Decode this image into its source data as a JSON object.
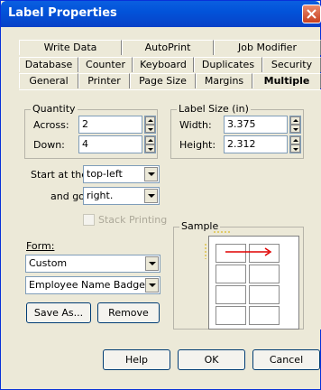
{
  "window": {
    "title": "Label Properties",
    "close_icon": "close-x-icon"
  },
  "tabs": {
    "row1": [
      "Write Data",
      "AutoPrint",
      "Job Modifier"
    ],
    "row2": [
      "Database",
      "Counter",
      "Keyboard",
      "Duplicates",
      "Security"
    ],
    "row3": [
      "General",
      "Printer",
      "Page Size",
      "Margins",
      "Multiple"
    ],
    "active": "Multiple"
  },
  "quantity": {
    "title": "Quantity",
    "across_label": "Across:",
    "across_value": "2",
    "down_label": "Down:",
    "down_value": "4"
  },
  "label_size": {
    "title": "Label Size (in)",
    "width_label": "Width:",
    "width_value": "3.375",
    "height_label": "Height:",
    "height_value": "2.312"
  },
  "start": {
    "start_label": "Start at the",
    "start_value": "top-left",
    "go_label": "and go",
    "go_value": "right."
  },
  "stack_printing": {
    "label": "Stack Printing",
    "checked": false,
    "enabled": false
  },
  "form": {
    "label": "Form:",
    "form_value": "Custom",
    "template_value": "Employee Name Badge"
  },
  "buttons": {
    "save_as": "Save As...",
    "remove": "Remove"
  },
  "sample": {
    "title": "Sample",
    "arrow_color": "#e00000"
  },
  "footer": {
    "help": "Help",
    "ok": "OK",
    "cancel": "Cancel"
  }
}
